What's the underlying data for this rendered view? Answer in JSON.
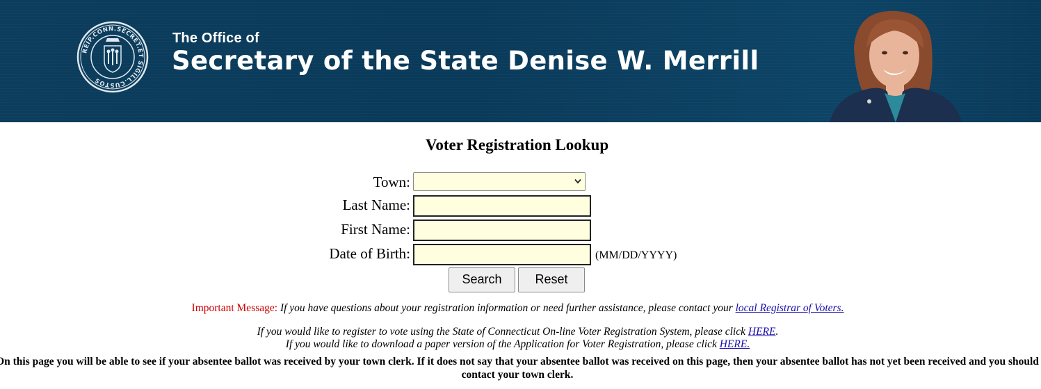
{
  "header": {
    "office_line": "The Office of",
    "title": "Secretary of the State Denise W. Merrill",
    "seal_text": "REIP.CONN.SECRET.ET SIGILL.CUSTOS",
    "background_color": "#0b3b5b"
  },
  "page": {
    "heading": "Voter Registration Lookup"
  },
  "form": {
    "town_label": "Town:",
    "town_value": "",
    "last_name_label": "Last Name:",
    "last_name_value": "",
    "first_name_label": "First Name:",
    "first_name_value": "",
    "dob_label": "Date of Birth:",
    "dob_value": "",
    "dob_format": "(MM/DD/YYYY)",
    "search_label": "Search",
    "reset_label": "Reset",
    "field_background": "#ffffe0"
  },
  "messages": {
    "important_label": "Important Message:",
    "important_text": "If you have questions about your registration information or need further assistance, please contact your",
    "important_link": "local Registrar of Voters.",
    "register_online_text": "If you would like to register to vote using the State of Connecticut On-line Voter Registration System, please click",
    "register_online_link": "HERE",
    "register_online_suffix": ".",
    "register_paper_text": "If you would like to download a paper version of the Application for Voter Registration, please click",
    "register_paper_link": "HERE.",
    "absentee_notice": "On this page you will be able to see if your absentee ballot was received by your town clerk. If it does not say that your absentee ballot was received on this page, then your absentee ballot has not yet been received and you should contact your town clerk."
  }
}
